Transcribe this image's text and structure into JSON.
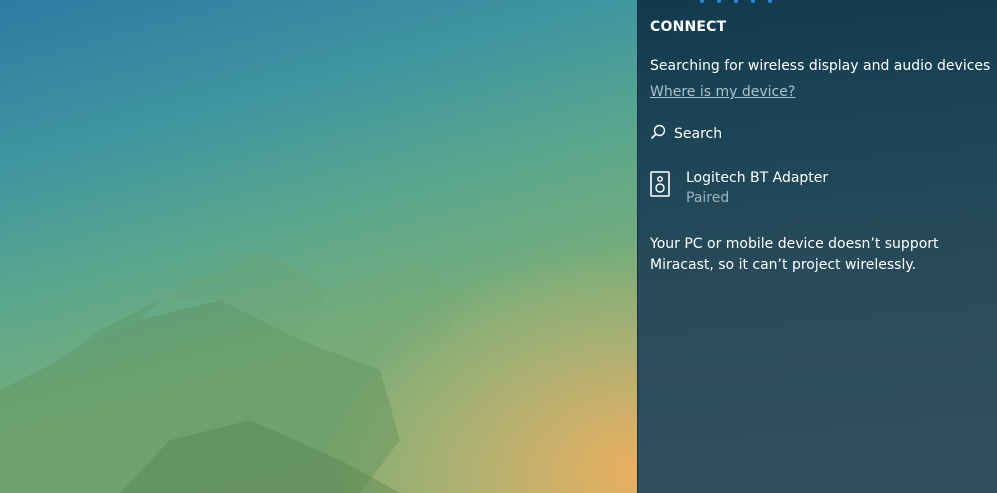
{
  "panel": {
    "title": "CONNECT",
    "status": "Searching for wireless display and audio devices",
    "help_link": "Where is my device?",
    "search_label": "Search",
    "devices": [
      {
        "name": "Logitech BT Adapter",
        "state": "Paired",
        "icon": "speaker-icon"
      }
    ],
    "notice": "Your PC or mobile device doesn’t support Miracast, so it can’t project wirelessly."
  },
  "colors": {
    "panel_background": "#1d4658",
    "text": "#ffffff",
    "link": "#a9c3cf",
    "secondary_text": "#9fb3bd",
    "accent": "#2a8ad8"
  }
}
